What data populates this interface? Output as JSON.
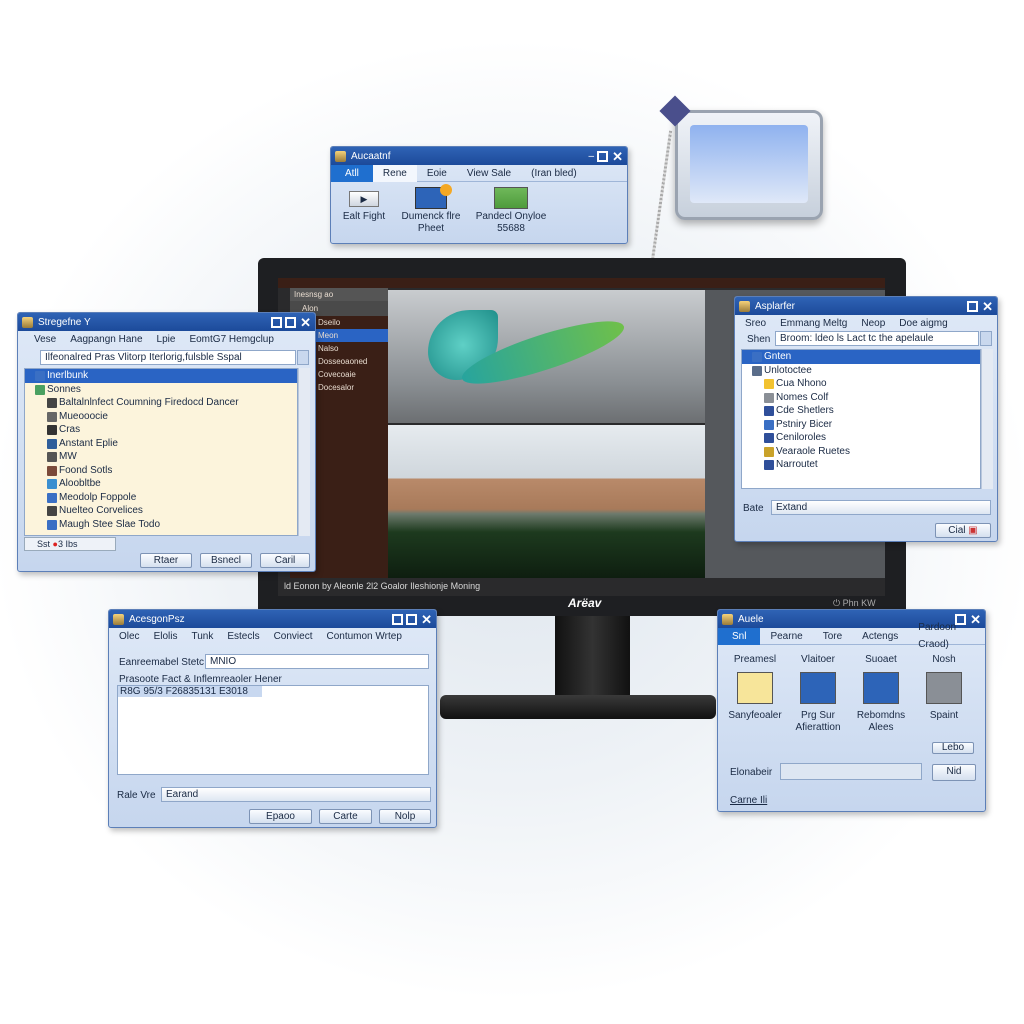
{
  "top_window": {
    "title": "Aucaatnf",
    "tabs": [
      "Atll",
      "Rene",
      "Eoie",
      "View Sale",
      "(Iran bled)"
    ],
    "items": [
      {
        "label": "Ealt Fight",
        "icon": "play-icon"
      },
      {
        "label": "Dumenck flre Pheet",
        "icon": "settings-badge-icon"
      },
      {
        "label": "Pandecl Onyloe 55688",
        "icon": "image-icon"
      }
    ]
  },
  "monitor": {
    "brand": "Arëav",
    "status_bar": "ld Eonon by Aleonle 2l2 Goalor Ileshionje Moning",
    "power_label": "Phn KW",
    "panel_title": "Inesnsg ao",
    "panel_items": [
      "Alon",
      "Dseilo",
      "Meon",
      "Nalso",
      "Dosseoaoned",
      "Covecoaie",
      "Docesalor"
    ],
    "colors": {
      "bezel": "#1e1f22",
      "panel": "#3a1f16"
    }
  },
  "left_window": {
    "title": "Stregefne Y",
    "menu": [
      "Vese",
      "Aagpangn Hane",
      "Lpie",
      "EomtG7 Hemgclup"
    ],
    "path": "Ilfeonalred Pras Vlitorp Iterlorig,fulsble Sspal",
    "tree": [
      {
        "label": "Inerlbunk",
        "selected": true
      },
      {
        "label": "Sonnes"
      },
      {
        "label": "Baltalnlnfect Coumning Firedocd Dancer"
      },
      {
        "label": "Mueooocie"
      },
      {
        "label": "Cras"
      },
      {
        "label": "Anstant Eplie"
      },
      {
        "label": "MW"
      },
      {
        "label": "Foond Sotls"
      },
      {
        "label": "Aloobltbe"
      },
      {
        "label": "Meodolp Foppole"
      },
      {
        "label": "Nuelteo Corvelices"
      },
      {
        "label": "Maugh Stee Slae Todo"
      }
    ],
    "status": [
      "Sst",
      "3 Ibs"
    ],
    "buttons": [
      "Rtaer",
      "Bsnecl",
      "Caril"
    ]
  },
  "right_window": {
    "title": "Asplarfer",
    "menu": [
      "Sreo",
      "Emmang Meltg",
      "Neop",
      "Doe aigmg"
    ],
    "show_label": "Shen",
    "path": "Broom: ldeo ls Lact tc the apelaule",
    "tree": [
      {
        "label": "Gnten",
        "selected": true
      },
      {
        "label": "Unlotoctee"
      },
      {
        "label": "Cua Nhono"
      },
      {
        "label": "Nomes Colf"
      },
      {
        "label": "Cde Shetlers"
      },
      {
        "label": "Pstniry Bicer"
      },
      {
        "label": "Ceniloroles"
      },
      {
        "label": "Vearaole Ruetes"
      },
      {
        "label": "Narroutet"
      }
    ],
    "combo_label": "Bate",
    "combo_value": "Extand",
    "button": "Cial"
  },
  "bottom_left_window": {
    "title": "AcesgonPsz",
    "menu": [
      "Olec",
      "Elolis",
      "Tunk",
      "Estecls",
      "Conviect",
      "Contumon Wrtep"
    ],
    "field_label": "Eanreemabel Stetc",
    "field_value": "MNIO",
    "area_label": "Prasoote Fact & Inflemreaoler Hener",
    "area_text": "R8G 95/3 F26835131 E3018",
    "combo_label": "Rale Vre",
    "combo_value": "Earand",
    "buttons": [
      "Epaoo",
      "Carte",
      "Nolp"
    ]
  },
  "bottom_right_window": {
    "title": "Auele",
    "tabs": [
      "Snl",
      "Pearne",
      "Tore",
      "Actengs",
      "Pardoon Craod)"
    ],
    "items": [
      {
        "header": "Preamesl",
        "label": "Sanyfeoaler",
        "icon": "folder-icon"
      },
      {
        "header": "Vlaitoer",
        "label": "Prg Sur Afierattion",
        "icon": "image-badge-icon"
      },
      {
        "header": "Suoaet",
        "label": "Rebomdns Alees",
        "icon": "settings-badge-icon"
      },
      {
        "header": "Nosh",
        "label": "Spaint",
        "icon": "device-icon"
      }
    ],
    "small_button": "Lebo",
    "field_label": "Elonabeir",
    "go_button": "Nid",
    "link": "Carne Ili"
  }
}
